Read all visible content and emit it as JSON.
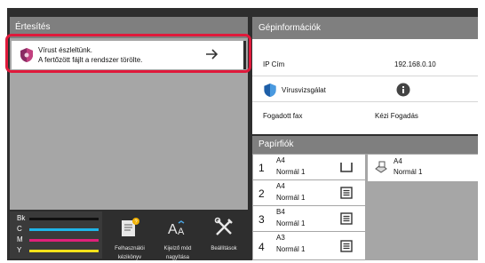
{
  "notifications": {
    "title": "Értesítés",
    "item_line1": "Vírust észleltünk.",
    "item_line2": "A fertőzött fájlt a rendszer törölte."
  },
  "machine_info": {
    "title": "Gépinformációk",
    "ip_label": "IP Cím",
    "ip_value": "192.168.0.10",
    "virus_label": "Vírusvizsgálat",
    "fax_label": "Fogadott fax",
    "fax_value": "Kézi Fogadás"
  },
  "paper_trays": {
    "title": "Papírfiók",
    "trays": [
      {
        "num": "1",
        "size": "A4",
        "type": "Normál 1"
      },
      {
        "num": "2",
        "size": "A4",
        "type": "Normál 1"
      },
      {
        "num": "3",
        "size": "B4",
        "type": "Normál 1"
      },
      {
        "num": "4",
        "size": "A3",
        "type": "Normál 1"
      }
    ],
    "bypass": {
      "size": "A4",
      "type": "Normál 1"
    }
  },
  "toner": [
    {
      "label": "Bk",
      "color": "#111111"
    },
    {
      "label": "C",
      "color": "#1fb5e8"
    },
    {
      "label": "M",
      "color": "#e0207a"
    },
    {
      "label": "Y",
      "color": "#f3e11a"
    }
  ],
  "shortcuts": {
    "manual": {
      "line1": "Felhasználói",
      "line2": "kézikönyv"
    },
    "display": {
      "line1": "Kijelző mód",
      "line2": "nagyítása"
    },
    "settings": {
      "line1": "Beállítások"
    }
  },
  "colors": {
    "alert_ring": "#e0193b",
    "panel_header": "#7f7f7f",
    "frame": "#2e2e2e"
  }
}
